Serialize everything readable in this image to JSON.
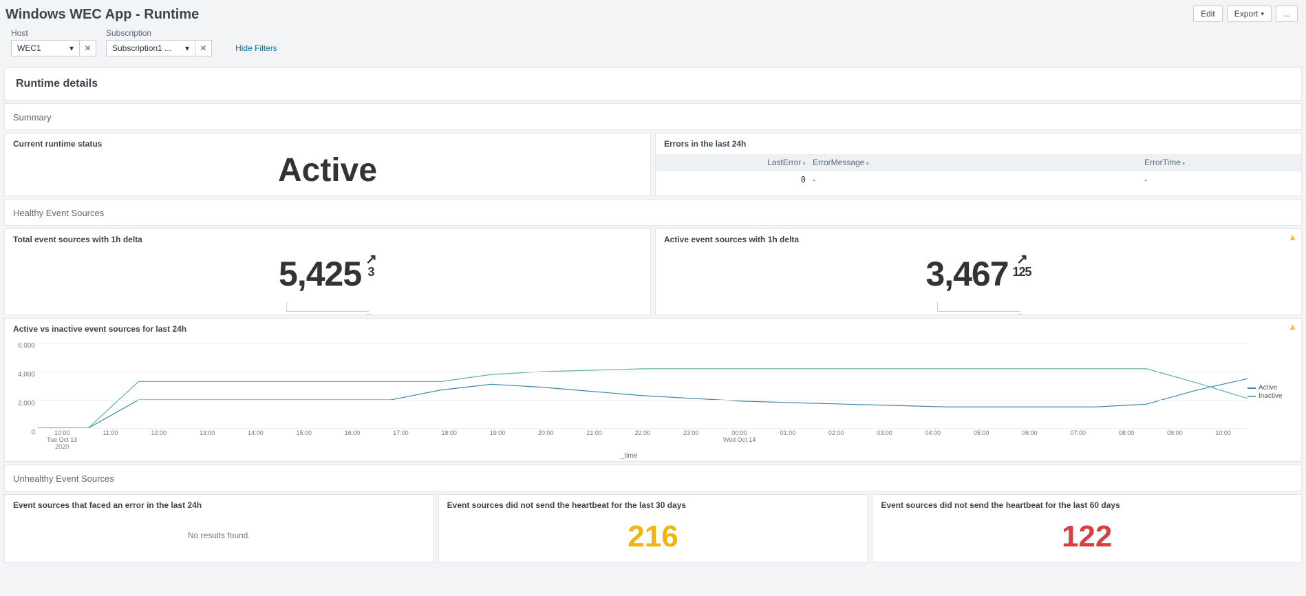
{
  "header": {
    "title": "Windows WEC App - Runtime",
    "edit": "Edit",
    "export": "Export",
    "more": "..."
  },
  "filters": {
    "host": {
      "label": "Host",
      "value": "WEC1"
    },
    "subscription": {
      "label": "Subscription",
      "value": "Subscription1 ..."
    },
    "hide": "Hide Filters"
  },
  "sections": {
    "runtime_details": "Runtime details",
    "summary": "Summary",
    "healthy": "Healthy Event Sources",
    "unhealthy": "Unhealthy Event Sources"
  },
  "cards": {
    "status": {
      "title": "Current runtime status",
      "value": "Active"
    },
    "errors24h": {
      "title": "Errors in the last 24h",
      "cols": {
        "last_error": "LastError",
        "message": "ErrorMessage",
        "time": "ErrorTime"
      },
      "rows": [
        {
          "last_error": "0",
          "message": "-",
          "time": "-"
        }
      ]
    },
    "total_sources": {
      "title": "Total event sources with 1h delta",
      "value": "5,425",
      "delta": "3"
    },
    "active_sources": {
      "title": "Active event sources with 1h delta",
      "value": "3,467",
      "delta": "125"
    },
    "err_24h_sources": {
      "title": "Event sources that faced an error in the last 24h",
      "no_results": "No results found."
    },
    "hb30": {
      "title": "Event sources did not send the heartbeat for the last 30 days",
      "value": "216"
    },
    "hb60": {
      "title": "Event sources did not send the heartbeat for the last 60 days",
      "value": "122"
    }
  },
  "chart": {
    "title": "Active vs inactive event sources for last 24h",
    "xlabel": "_time",
    "legend": {
      "active": "Active",
      "inactive": "Inactive"
    },
    "colors": {
      "active": "#3a87ad",
      "inactive": "#5fb29a"
    }
  },
  "chart_data": {
    "type": "line",
    "xlabel": "_time",
    "ylabel": "",
    "ylim": [
      0,
      6000
    ],
    "y_ticks": [
      "6,000",
      "4,000",
      "2,000",
      "0"
    ],
    "x_ticks": [
      {
        "t": "10:00",
        "sub": "Tue Oct 13",
        "sub2": "2020"
      },
      {
        "t": "11:00"
      },
      {
        "t": "12:00"
      },
      {
        "t": "13:00"
      },
      {
        "t": "14:00"
      },
      {
        "t": "15:00"
      },
      {
        "t": "16:00"
      },
      {
        "t": "17:00"
      },
      {
        "t": "18:00"
      },
      {
        "t": "19:00"
      },
      {
        "t": "20:00"
      },
      {
        "t": "21:00"
      },
      {
        "t": "22:00"
      },
      {
        "t": "23:00"
      },
      {
        "t": "00:00",
        "sub": "Wed Oct 14"
      },
      {
        "t": "01:00"
      },
      {
        "t": "02:00"
      },
      {
        "t": "03:00"
      },
      {
        "t": "04:00"
      },
      {
        "t": "05:00"
      },
      {
        "t": "06:00"
      },
      {
        "t": "07:00"
      },
      {
        "t": "08:00"
      },
      {
        "t": "09:00"
      },
      {
        "t": "10:00"
      }
    ],
    "series": [
      {
        "name": "Active",
        "color": "#3a87ad",
        "values": [
          0,
          0,
          2000,
          2000,
          2000,
          2000,
          2000,
          2000,
          2700,
          3100,
          2900,
          2600,
          2300,
          2100,
          1900,
          1800,
          1700,
          1600,
          1500,
          1500,
          1500,
          1500,
          1700,
          2700,
          3500
        ]
      },
      {
        "name": "Inactive",
        "color": "#5fb29a",
        "values": [
          0,
          0,
          3300,
          3300,
          3300,
          3300,
          3300,
          3300,
          3300,
          3800,
          4000,
          4100,
          4200,
          4200,
          4200,
          4200,
          4200,
          4200,
          4200,
          4200,
          4200,
          4200,
          4200,
          3200,
          2100
        ]
      }
    ]
  }
}
